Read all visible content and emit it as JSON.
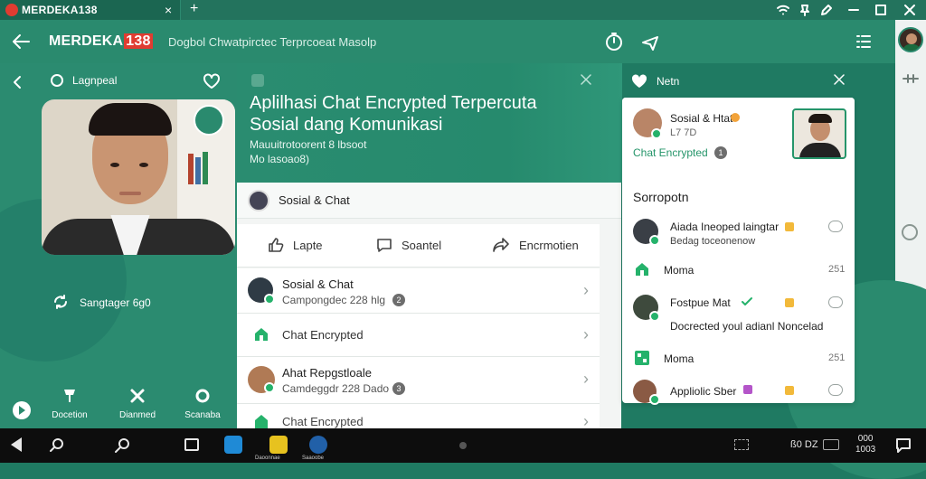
{
  "window": {
    "tab_title": "MERDEKA138",
    "tab_close": "×",
    "tab_add": "+"
  },
  "header": {
    "brand_prefix": "MERDEKA",
    "brand_suffix": "138",
    "subtitle": "Dogbol Chwatpirctec Terprcoeat Masolp"
  },
  "left": {
    "top_label": "Lagnpeal",
    "status_text": "Sangtager 6g0",
    "bottom_actions": [
      {
        "label": "Docetion"
      },
      {
        "label": "Dianmed"
      },
      {
        "label": "Scanaba"
      }
    ]
  },
  "hero": {
    "title_line1": "Aplilhasi Chat Encrypted Terpercuta",
    "title_line2": "Sosial dang Komunikasi",
    "meta_line1": "Mauuitrotoorent 8 lbsoot",
    "meta_line2": "Mo lasoao8)"
  },
  "center": {
    "section_header": "Sosial & Chat",
    "actions": [
      {
        "label": "Lapte"
      },
      {
        "label": "Soantel"
      },
      {
        "label": "Encrmotien"
      }
    ],
    "rows": [
      {
        "title": "Sosial & Chat",
        "subtitle": "Campongdec 228 hlg",
        "count": "2"
      },
      {
        "title": "Chat Encrypted"
      },
      {
        "title": "Ahat Repgstloale",
        "subtitle": "Camdeggdr 228 Dado",
        "count": "3"
      },
      {
        "title": "Chat Encrypted"
      }
    ]
  },
  "right": {
    "panel_title": "Netn",
    "top_name": "Sosial & Htat",
    "top_sub": "L7 7D",
    "top_link": "Chat Encrypted",
    "top_count": "1",
    "section": "Sorropotn",
    "items": [
      {
        "title": "Aiada Ineoped laingtar",
        "subtitle": "Bedag toceonenow"
      },
      {
        "title": "Moma",
        "value": "251"
      },
      {
        "title": "Fostpue Mat",
        "subtitle": "Docrected youl adianl Noncelad"
      },
      {
        "title": "Moma",
        "value": "251"
      },
      {
        "title": "Appliolic Sber"
      }
    ]
  },
  "taskbar": {
    "app_labels": [
      "Daoonnae",
      "Saaoobe"
    ],
    "tray_clock_line1": "000",
    "tray_clock_line2": "1003",
    "tray_text": "ß0 DZ"
  },
  "colors": {
    "accent": "#2a8a6e",
    "brand_red": "#e03c31",
    "success": "#25b26b"
  }
}
